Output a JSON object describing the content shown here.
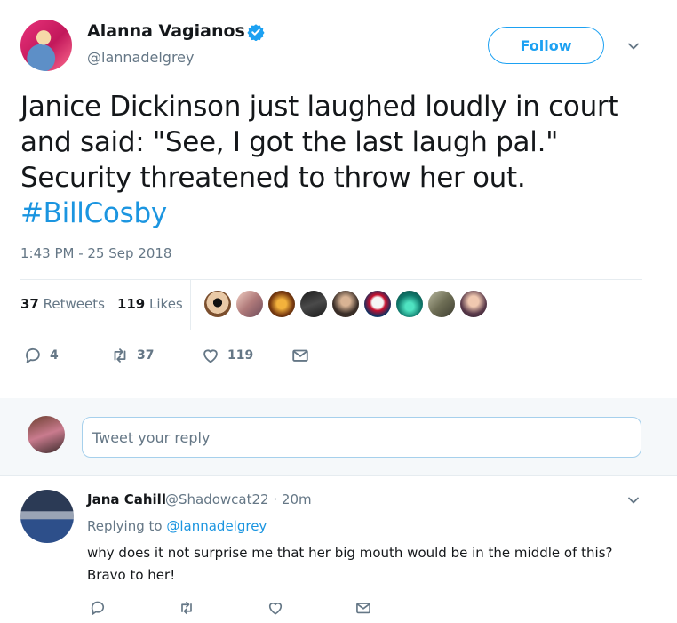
{
  "tweet": {
    "author_name": "Alanna Vagianos",
    "author_handle": "@lannadelgrey",
    "follow_label": "Follow",
    "text_line1": "Janice Dickinson just laughed loudly in court",
    "text_line2": "and said: \"See, I got the last laugh pal.\"",
    "text_line3": "Security threatened to throw her out.",
    "hashtag": "#BillCosby",
    "timestamp": "1:43 PM - 25 Sep 2018",
    "retweets_count": "37",
    "retweets_label": "Retweets",
    "likes_count": "119",
    "likes_label": "Likes",
    "actions": {
      "reply_count": "4",
      "retweet_count": "37",
      "like_count": "119"
    },
    "icons": [
      "verified-icon",
      "chevron-down-icon",
      "reply-icon",
      "retweet-icon",
      "heart-icon",
      "mail-icon"
    ]
  },
  "reply_box": {
    "placeholder": "Tweet your reply"
  },
  "reply": {
    "author_name": "Jana Cahill",
    "meta": "@Shadowcat22 · 20m",
    "replying_prefix": "Replying to",
    "replying_handle": "@lannadelgrey",
    "text_line1": "why does it not surprise me that her big mouth would be in the middle of this?",
    "text_line2": "Bravo to her!"
  },
  "colors": {
    "accent": "#1da1f2",
    "link": "#1b95e0",
    "secondary_text": "#657786",
    "divider": "#e6ecf0",
    "reply_bg": "#f5f8fa"
  }
}
